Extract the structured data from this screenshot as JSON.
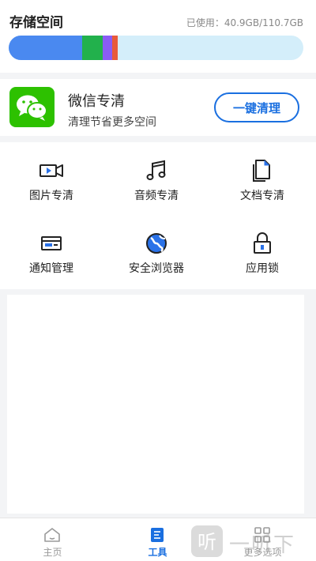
{
  "storage": {
    "title": "存储空间",
    "used": "已使用：40.9GB/110.7GB",
    "segments": [
      "#4a89f0",
      "#22b14c",
      "#8a5cf5",
      "#e85a3a"
    ],
    "segment_fractions": [
      0.25,
      0.07,
      0.03,
      0.02
    ],
    "track_color": "#d4eefa"
  },
  "wechat": {
    "title": "微信专清",
    "subtitle": "清理节省更多空间",
    "button": "一键清理",
    "logo_color": "#2dc100"
  },
  "tools": [
    {
      "label": "图片专清",
      "icon": "video-icon"
    },
    {
      "label": "音频专清",
      "icon": "music-note-icon"
    },
    {
      "label": "文档专清",
      "icon": "document-icon"
    },
    {
      "label": "通知管理",
      "icon": "notification-icon"
    },
    {
      "label": "安全浏览器",
      "icon": "globe-icon"
    },
    {
      "label": "应用锁",
      "icon": "lock-icon"
    }
  ],
  "tabs": [
    {
      "label": "主页",
      "icon": "home-icon"
    },
    {
      "label": "工具",
      "icon": "tools-icon",
      "active": true
    },
    {
      "label": "更多选项",
      "icon": "grid-icon"
    }
  ],
  "accent_color": "#1a6fe0",
  "watermark": {
    "logo_text": "听",
    "text": "一听下载"
  }
}
